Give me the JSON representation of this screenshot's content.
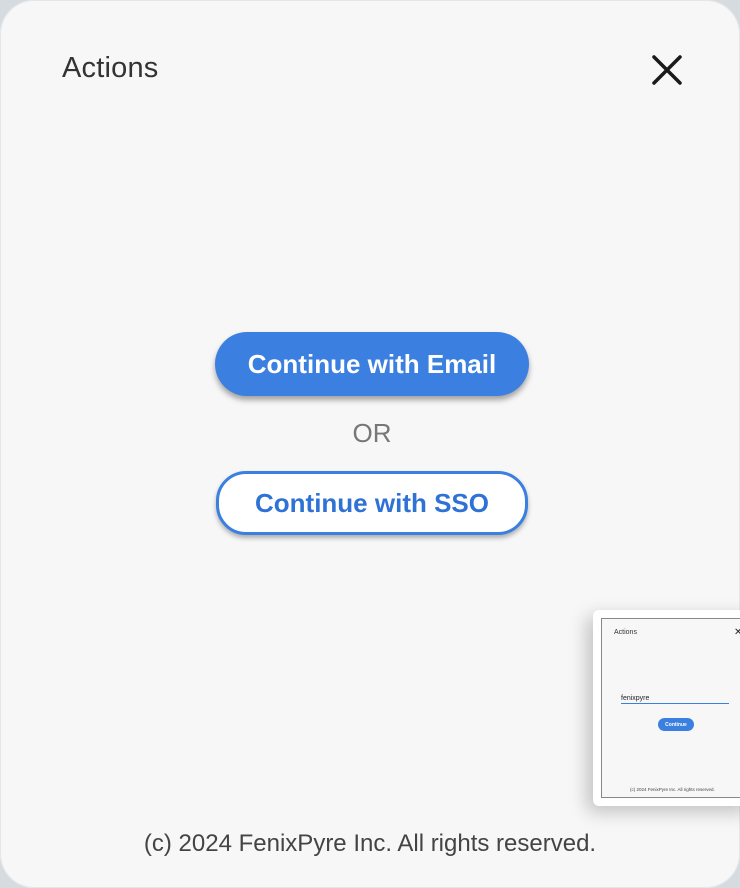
{
  "dialog": {
    "title": "Actions",
    "close_icon": "close-icon",
    "email_button_label": "Continue with Email",
    "or_label": "OR",
    "sso_button_label": "Continue with SSO",
    "footer": "(c) 2024 FenixPyre Inc.  All rights reserved."
  },
  "preview": {
    "title": "Actions",
    "close_glyph": "✕",
    "username_value": "fenixpyre",
    "continue_label": "Continue",
    "footer": "(c) 2024 FenixPyre Inc.  All rights reserved."
  },
  "colors": {
    "accent": "#3b7fe0",
    "background": "#f7f7f7"
  }
}
